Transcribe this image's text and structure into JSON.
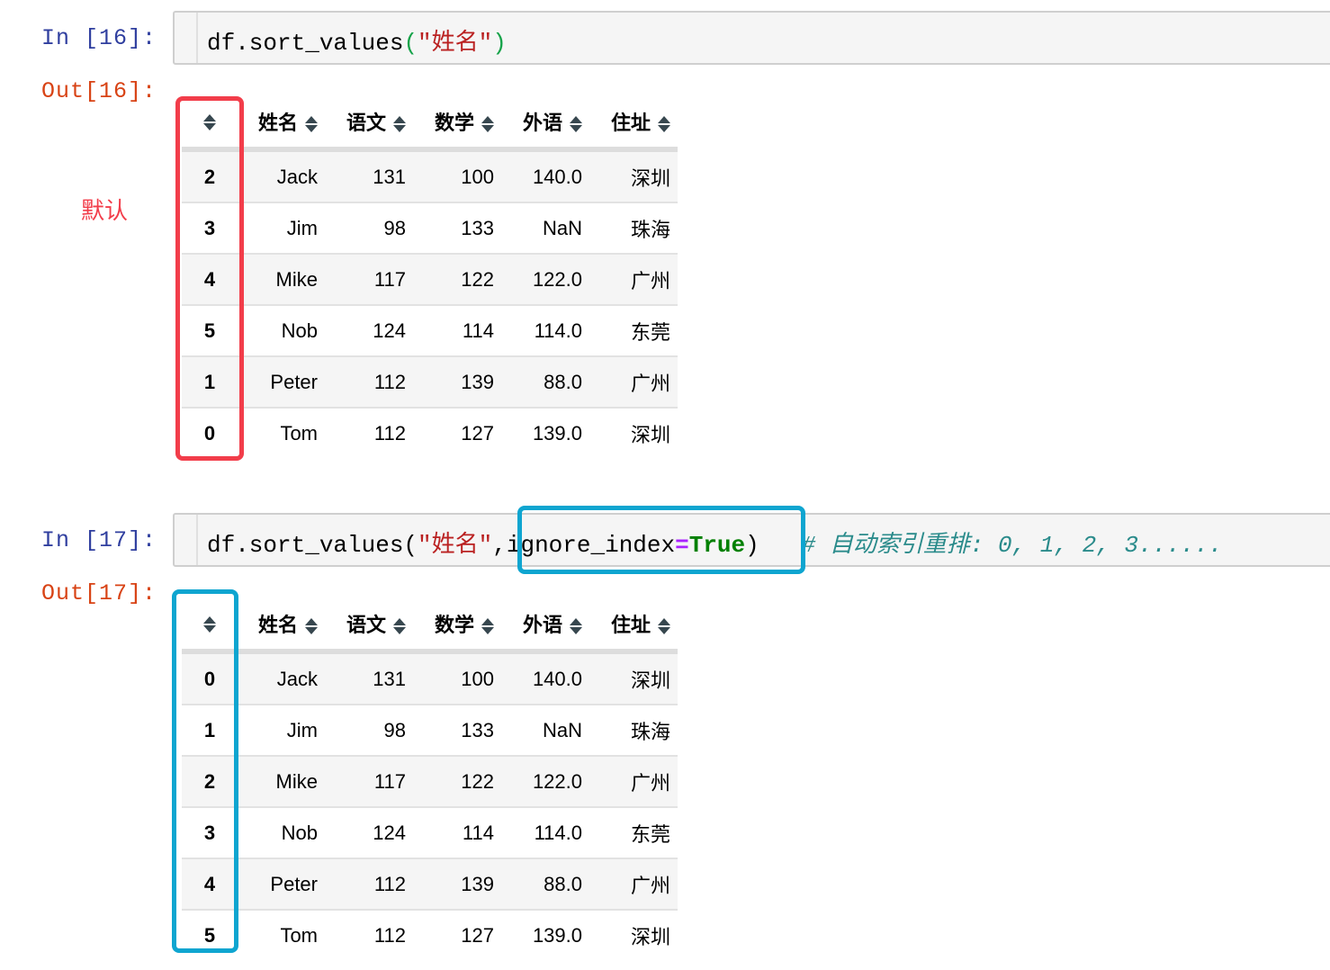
{
  "colors": {
    "prompt_in": "#303f9f",
    "prompt_out": "#d84315",
    "string": "#ba2121",
    "keyword": "#008000",
    "operator": "#aa22ff",
    "comment": "#2a8b8b",
    "highlight_red": "#f23d4a",
    "highlight_blue": "#0ea5d0"
  },
  "cells": [
    {
      "in_prompt": "In [16]:",
      "out_prompt": "Out[16]:",
      "code": {
        "call": "df.sort_values",
        "open_paren": "(",
        "arg": "\"姓名\"",
        "close_paren": ")"
      },
      "annotation": "默认",
      "table": {
        "columns": [
          "姓名",
          "语文",
          "数学",
          "外语",
          "住址"
        ],
        "rows": [
          {
            "index": "2",
            "values": [
              "Jack",
              "131",
              "100",
              "140.0",
              "深圳"
            ]
          },
          {
            "index": "3",
            "values": [
              "Jim",
              "98",
              "133",
              "NaN",
              "珠海"
            ]
          },
          {
            "index": "4",
            "values": [
              "Mike",
              "117",
              "122",
              "122.0",
              "广州"
            ]
          },
          {
            "index": "5",
            "values": [
              "Nob",
              "124",
              "114",
              "114.0",
              "东莞"
            ]
          },
          {
            "index": "1",
            "values": [
              "Peter",
              "112",
              "139",
              "88.0",
              "广州"
            ]
          },
          {
            "index": "0",
            "values": [
              "Tom",
              "112",
              "127",
              "139.0",
              "深圳"
            ]
          }
        ]
      }
    },
    {
      "in_prompt": "In [17]:",
      "out_prompt": "Out[17]:",
      "code": {
        "call": "df.sort_values(",
        "arg": "\"姓名\"",
        "comma": ",",
        "kwarg": "ignore_index",
        "eq": "=",
        "kwval": "True",
        "close_paren": ")",
        "comment": "# 自动索引重排: 0, 1, 2, 3......"
      },
      "table": {
        "columns": [
          "姓名",
          "语文",
          "数学",
          "外语",
          "住址"
        ],
        "rows": [
          {
            "index": "0",
            "values": [
              "Jack",
              "131",
              "100",
              "140.0",
              "深圳"
            ]
          },
          {
            "index": "1",
            "values": [
              "Jim",
              "98",
              "133",
              "NaN",
              "珠海"
            ]
          },
          {
            "index": "2",
            "values": [
              "Mike",
              "117",
              "122",
              "122.0",
              "广州"
            ]
          },
          {
            "index": "3",
            "values": [
              "Nob",
              "124",
              "114",
              "114.0",
              "东莞"
            ]
          },
          {
            "index": "4",
            "values": [
              "Peter",
              "112",
              "139",
              "88.0",
              "广州"
            ]
          },
          {
            "index": "5",
            "values": [
              "Tom",
              "112",
              "127",
              "139.0",
              "深圳"
            ]
          }
        ]
      }
    }
  ]
}
